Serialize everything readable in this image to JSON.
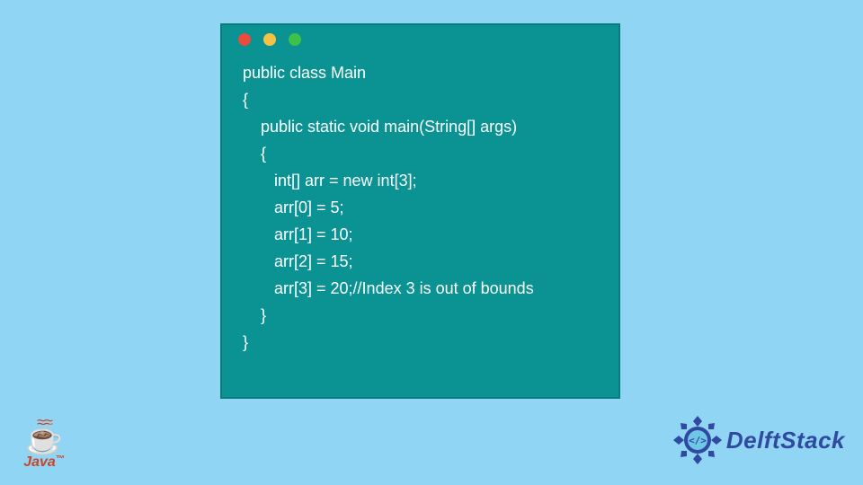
{
  "code": {
    "lines": [
      " public class Main",
      " {",
      "     public static void main(String[] args)",
      "     {",
      "        int[] arr = new int[3];",
      "        arr[0] = 5;",
      "        arr[1] = 10;",
      "        arr[2] = 15;",
      "        arr[3] = 20;//Index 3 is out of bounds",
      "     }",
      " }"
    ]
  },
  "window": {
    "dots": {
      "red": "#e94b3c",
      "yellow": "#f6c244",
      "green": "#3cc24a"
    },
    "bg": "#0b9393"
  },
  "logos": {
    "java": {
      "word": "Java",
      "trademark": "™"
    },
    "delft": {
      "word": "DelftStack",
      "inner": "</>"
    }
  },
  "page_bg": "#90d5f4"
}
